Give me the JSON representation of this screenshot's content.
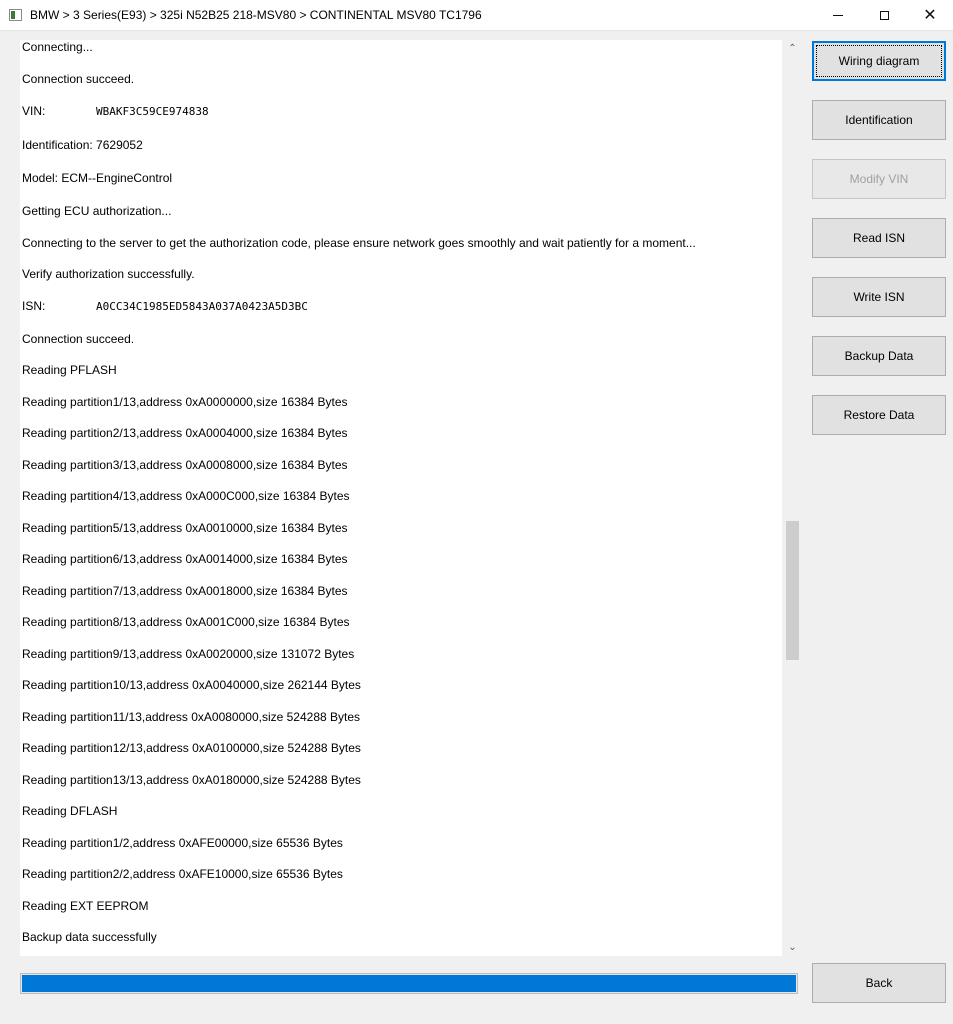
{
  "window": {
    "title": "BMW > 3 Series(E93) > 325i N52B25 218-MSV80 > CONTINENTAL MSV80 TC1796",
    "minimize": "—",
    "maximize": "",
    "close": "✕"
  },
  "log": {
    "lines": [
      "Connecting...",
      "Connection succeed.",
      "VIN:       WBAKF3C59CE974838",
      "Identification: 7629052",
      "Model: ECM--EngineControl",
      "Getting ECU authorization...",
      "Connecting to the server to get the authorization code, please ensure network goes smoothly and wait patiently for a moment...",
      "Verify authorization successfully.",
      "ISN:       A0CC34C1985ED5843A037A0423A5D3BC",
      "Connection succeed.",
      "Reading PFLASH",
      "Reading partition1/13,address 0xA0000000,size 16384 Bytes",
      "Reading partition2/13,address 0xA0004000,size 16384 Bytes",
      "Reading partition3/13,address 0xA0008000,size 16384 Bytes",
      "Reading partition4/13,address 0xA000C000,size 16384 Bytes",
      "Reading partition5/13,address 0xA0010000,size 16384 Bytes",
      "Reading partition6/13,address 0xA0014000,size 16384 Bytes",
      "Reading partition7/13,address 0xA0018000,size 16384 Bytes",
      "Reading partition8/13,address 0xA001C000,size 16384 Bytes",
      "Reading partition9/13,address 0xA0020000,size 131072 Bytes",
      "Reading partition10/13,address 0xA0040000,size 262144 Bytes",
      "Reading partition11/13,address 0xA0080000,size 524288 Bytes",
      "Reading partition12/13,address 0xA0100000,size 524288 Bytes",
      "Reading partition13/13,address 0xA0180000,size 524288 Bytes",
      "Reading DFLASH",
      "Reading partition1/2,address 0xAFE00000,size 65536 Bytes",
      "Reading partition2/2,address 0xAFE10000,size 65536 Bytes",
      "Reading EXT EEPROM",
      "Backup data successfully"
    ]
  },
  "buttons": {
    "wiring_diagram": "Wiring diagram",
    "identification": "Identification",
    "modify_vin": "Modify VIN",
    "read_isn": "Read  ISN",
    "write_isn": "Write  ISN",
    "backup_data": "Backup Data",
    "restore_data": "Restore Data",
    "back": "Back"
  },
  "scrollbar": {
    "up_arrow": "⌃",
    "down_arrow": "⌄"
  },
  "progress": {
    "percent": 100
  },
  "colors": {
    "accent": "#0078d7",
    "window_bg": "#f0f0f0",
    "log_bg": "#ffffff",
    "disabled_text": "#a0a0a0"
  }
}
